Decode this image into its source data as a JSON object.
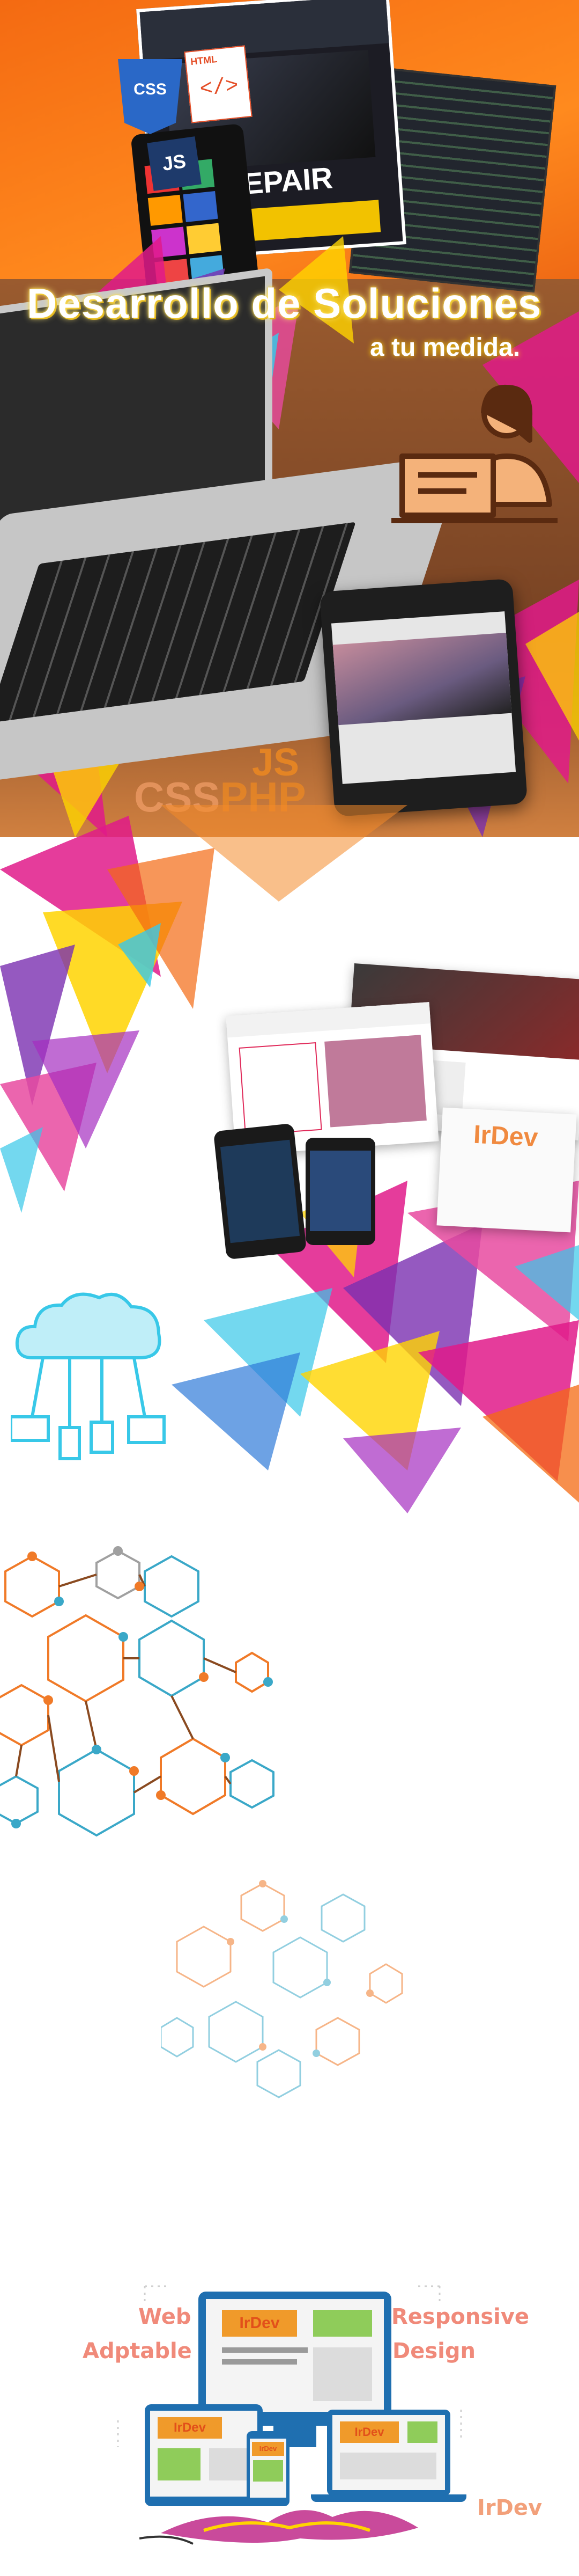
{
  "hero": {
    "headline": "Desarrollo de Soluciones",
    "subline": "a tu medida.",
    "badges": {
      "css": "CSS",
      "html": "HTML",
      "js": "JS"
    },
    "tech": {
      "js": "JS",
      "css": "CSS",
      "php": "PHP"
    },
    "mock_title": "REPAIR"
  },
  "section2": {
    "mockup_logo": "IrDev"
  },
  "responsive": {
    "label_web": "Web",
    "label_adaptable": "Adptable",
    "label_responsive": "Responsive",
    "label_design": "Design",
    "screen_logo": "IrDev",
    "brand": "IrDev"
  },
  "colors": {
    "orange": "#f46a12",
    "magenta": "#e01a8a",
    "purple": "#7a2fb0",
    "cyan": "#38c8e8",
    "yellow": "#ffd400",
    "hex_orange": "#f07a28",
    "hex_blue": "#3aa8c8",
    "label_salmon": "#f08a7a"
  }
}
